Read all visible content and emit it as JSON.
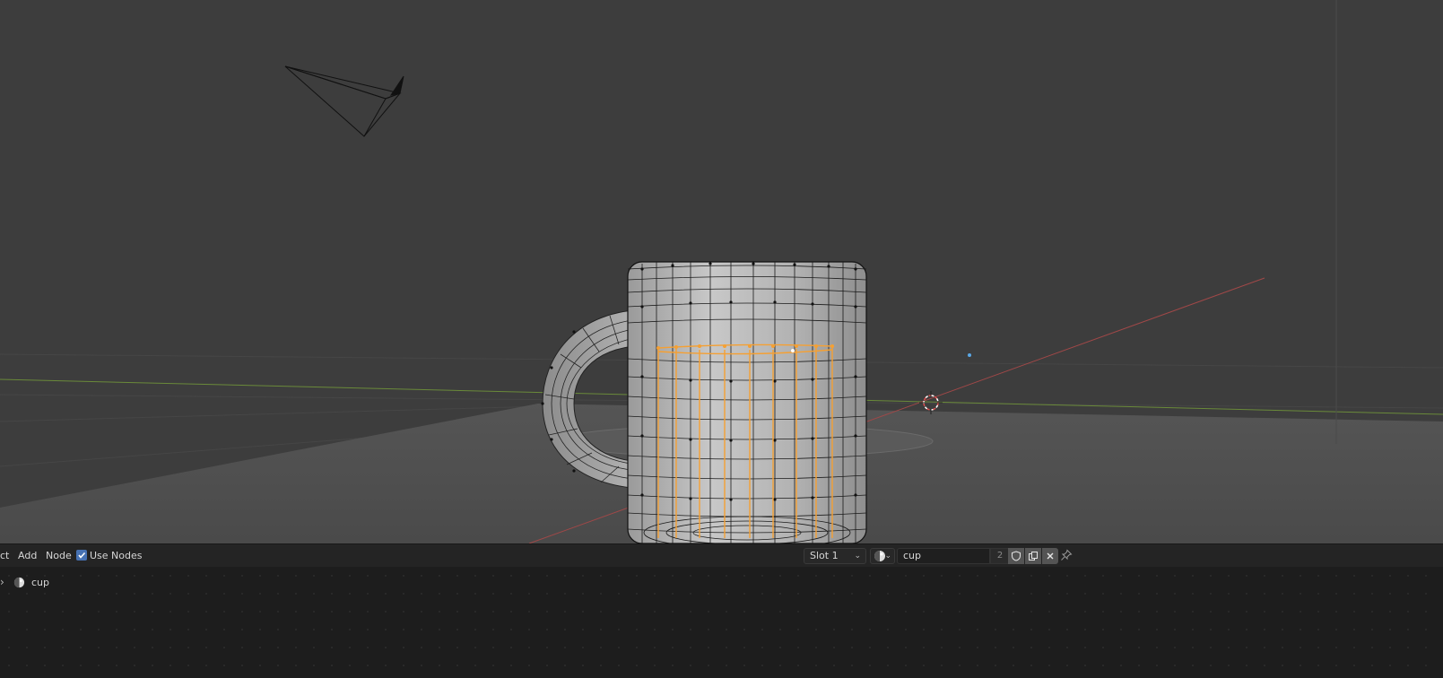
{
  "header": {
    "menus": [
      "ct",
      "Add",
      "Node"
    ],
    "use_nodes_label": "Use Nodes",
    "use_nodes_checked": true,
    "slot_label": "Slot 1",
    "material_name": "cup",
    "material_users": "2",
    "icons": [
      "material-sphere-icon",
      "fake-user-shield-icon",
      "duplicate-material-icon",
      "unlink-x-icon",
      "pin-icon"
    ]
  },
  "node_tree": {
    "items": [
      {
        "label": "cup",
        "icon": "material-sphere-icon"
      }
    ]
  },
  "colors": {
    "viewport_bg": "#3c3c3c",
    "header_bg": "#242424",
    "selection_orange": "#f5a033",
    "accent_blue": "#4772b3",
    "x_axis_red": "#a04848",
    "y_axis_green": "#6a8a3a"
  }
}
